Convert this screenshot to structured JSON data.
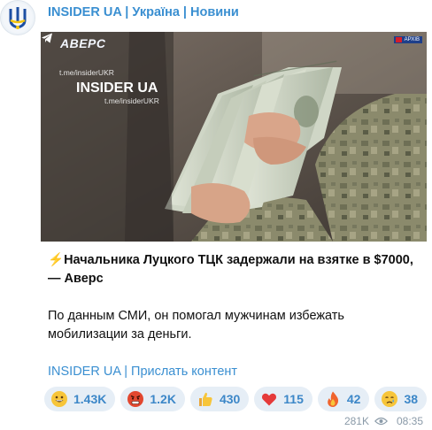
{
  "channel": {
    "name": "INSIDER UA | Україна | Новини"
  },
  "media": {
    "watermark_avers": "АВЕРС",
    "watermark_url_top": "t.me/insiderUKR",
    "watermark_brand": "INSIDER UA",
    "watermark_url_bottom": "t.me/insiderUKR",
    "watermark_archive": "АРХІВ"
  },
  "post": {
    "headline_icon": "⚡",
    "headline": "Начальника Луцкого ТЦК задержали на взятке в $7000, — Аверс",
    "body": "По данным СМИ, он помогал мужчинам избежать мобилизации за деньги.",
    "link_primary": "INSIDER UA",
    "link_separator": " | ",
    "link_secondary": "Прислать контент"
  },
  "reactions": [
    {
      "emoji": "grinning-face",
      "count": "1.43K"
    },
    {
      "emoji": "angry-face",
      "count": "1.2K"
    },
    {
      "emoji": "thumbs-up",
      "count": "430"
    },
    {
      "emoji": "red-heart",
      "count": "115"
    },
    {
      "emoji": "fire",
      "count": "42"
    },
    {
      "emoji": "crying-face",
      "count": "38"
    }
  ],
  "footer": {
    "views": "281K",
    "time": "08:35"
  },
  "colors": {
    "accent": "#3a8fd1",
    "reaction_bg": "#e6eef6",
    "text": "#111111",
    "meta": "#8a9aa8"
  }
}
